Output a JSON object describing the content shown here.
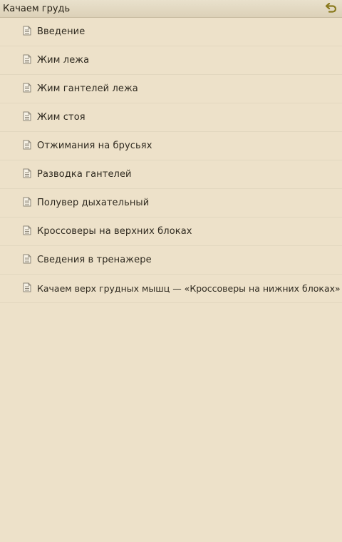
{
  "header": {
    "title": "Качаем грудь",
    "back_icon": "back-arrow-icon",
    "back_icon_color": "#8a7a1e"
  },
  "items": [
    {
      "label": "Введение",
      "icon": "document-icon"
    },
    {
      "label": "Жим лежа",
      "icon": "document-icon"
    },
    {
      "label": "Жим гантелей лежа",
      "icon": "document-icon"
    },
    {
      "label": "Жим стоя",
      "icon": "document-icon"
    },
    {
      "label": "Отжимания на брусьях",
      "icon": "document-icon"
    },
    {
      "label": "Разводка гантелей",
      "icon": "document-icon"
    },
    {
      "label": "Полувер дыхательный",
      "icon": "document-icon"
    },
    {
      "label": "Кроссоверы на верхних блоках",
      "icon": "document-icon"
    },
    {
      "label": "Сведения в тренажере",
      "icon": "document-icon"
    },
    {
      "label": "Качаем верх грудных мышц — «Кроссоверы на нижних блоках»",
      "icon": "document-icon"
    }
  ],
  "colors": {
    "background": "#ede1c9",
    "header_background": "#dcd1b8",
    "text": "#2f2a20"
  }
}
